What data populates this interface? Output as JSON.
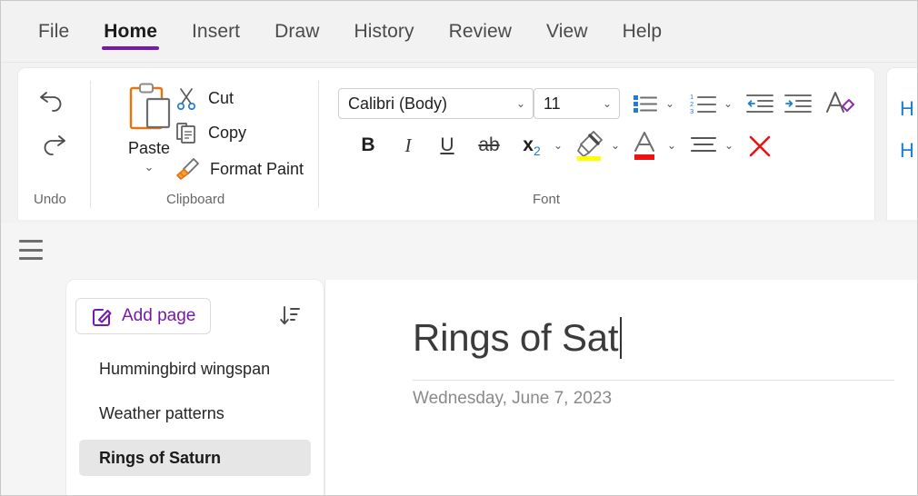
{
  "tabs": [
    {
      "label": "File",
      "active": false
    },
    {
      "label": "Home",
      "active": true
    },
    {
      "label": "Insert",
      "active": false
    },
    {
      "label": "Draw",
      "active": false
    },
    {
      "label": "History",
      "active": false
    },
    {
      "label": "Review",
      "active": false
    },
    {
      "label": "View",
      "active": false
    },
    {
      "label": "Help",
      "active": false
    }
  ],
  "ribbon": {
    "groups": {
      "undo": {
        "label": "Undo",
        "undo_icon": "undo-arrow-icon",
        "redo_icon": "redo-arrow-icon"
      },
      "clipboard": {
        "label": "Clipboard",
        "paste_label": "Paste",
        "paste_icon": "clipboard-paste-icon",
        "paste_chevron": "⌄",
        "cut_label": "Cut",
        "cut_icon": "scissors-icon",
        "copy_label": "Copy",
        "copy_icon": "copy-pages-icon",
        "format_paint_label": "Format Paint",
        "format_paint_icon": "paintbrush-icon"
      },
      "font": {
        "label": "Font",
        "font_name": "Calibri (Body)",
        "font_size": "11",
        "chevron": "⌄",
        "bold_label": "B",
        "italic_label": "I",
        "underline_label": "U",
        "strikethrough_label": "ab",
        "subscript_label": "x",
        "subscript_sub": "2",
        "highlight_icon": "highlighter-icon",
        "font_color_label": "A",
        "align_icon": "align-left-icon",
        "clear_format_icon": "red-x-icon",
        "bullets_icon": "bullet-list-icon",
        "numbering_icon": "numbered-list-icon",
        "decrease_indent_icon": "decrease-indent-icon",
        "increase_indent_icon": "increase-indent-icon",
        "styles_eraser_icon": "clear-formatting-icon"
      },
      "styles": {
        "peek_1": "H",
        "peek_2": "H"
      }
    }
  },
  "colors": {
    "accent_purple": "#7719aa",
    "highlight_yellow": "#ffff00",
    "font_color_red": "#ee1111",
    "blue_accent": "#1f7dd6",
    "orange": "#e8740c",
    "selected_page_bg": "#e6e6e6"
  },
  "navigation": {
    "hamburger_icon": "hamburger-menu-icon"
  },
  "pagelist": {
    "add_page_label": "Add page",
    "add_page_icon": "edit-page-icon",
    "sort_icon": "sort-descending-icon",
    "pages": [
      {
        "title": "Hummingbird wingspan",
        "selected": false
      },
      {
        "title": "Weather patterns",
        "selected": false
      },
      {
        "title": "Rings of Saturn",
        "selected": true
      }
    ]
  },
  "canvas": {
    "page_title": "Rings of Sat",
    "page_date": "Wednesday, June 7, 2023"
  }
}
